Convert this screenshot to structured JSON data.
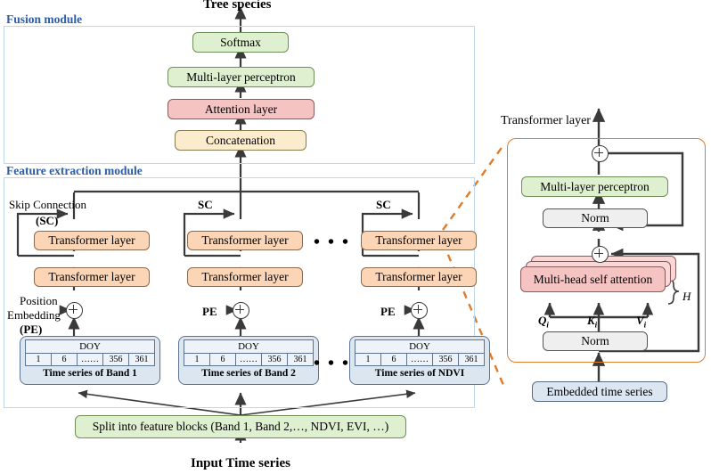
{
  "diagram": {
    "title_top": "Tree species",
    "title_bottom": "Input Time series",
    "transformer_panel_label": "Transformer  layer"
  },
  "modules": {
    "fusion": "Fusion module",
    "feature_extraction": "Feature extraction module"
  },
  "fusion_nodes": {
    "softmax": "Softmax",
    "mlp": "Multi-layer  perceptron",
    "attention": "Attention layer",
    "concatenation": "Concatenation"
  },
  "feature_extraction": {
    "skip_connection_label": "Skip Connection",
    "skip_connection_abbr": "(SC)",
    "sc_short": "SC",
    "position_embedding_line1": "Position",
    "position_embedding_line2": "Embedding",
    "position_embedding_abbr": "(PE)",
    "pe_short": "PE",
    "transformer_layer": "Transformer layer",
    "ellipsis": "• • •",
    "columns": [
      {
        "caption": "Time series of Band 1",
        "header": "DOY",
        "cells": [
          "1",
          "6",
          "……",
          "356",
          "361"
        ]
      },
      {
        "caption": "Time series of Band 2",
        "header": "DOY",
        "cells": [
          "1",
          "6",
          "……",
          "356",
          "361"
        ]
      },
      {
        "caption": "Time series of NDVI",
        "header": "DOY",
        "cells": [
          "1",
          "6",
          "……",
          "356",
          "361"
        ]
      }
    ]
  },
  "split_box": {
    "label": "Split into feature blocks (Band 1, Band 2,…, NDVI, EVI, …)"
  },
  "transformer_detail": {
    "mlp": "Multi-layer  perceptron",
    "norm_upper": "Norm",
    "norm_lower": "Norm",
    "msa": "Multi-head  self attention",
    "heads_symbol": "H",
    "q_label": "Q",
    "k_label": "K",
    "v_label": "V",
    "qkv_subscript": "i",
    "embedded": "Embedded time series"
  },
  "colors": {
    "module_border": "#bcd7ee",
    "module_label": "#2a5caa",
    "green": "#dff0d0",
    "pink": "#f6c3c3",
    "cream": "#fbeccd",
    "orange": "#fbd5b5",
    "grey": "#efefef",
    "blue": "#dce6f1",
    "panel_orange": "#e07b2a",
    "wire": "#3a3a3a"
  }
}
